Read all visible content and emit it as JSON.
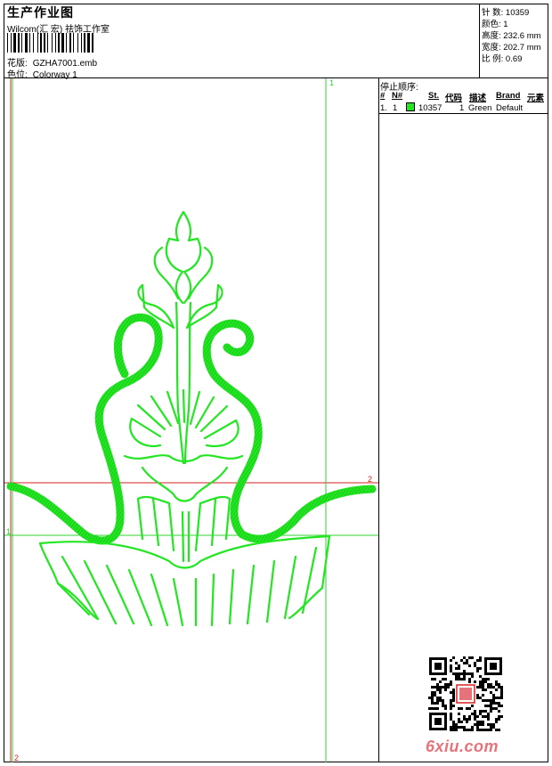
{
  "header": {
    "title": "生产作业图",
    "company": "Wilcom(汇 宏) 祛饰工作室",
    "design_label": "花版:",
    "design_value": "GZHA7001.emb",
    "colorway_label": "色位:",
    "colorway_value": "Colorway 1"
  },
  "stats": {
    "stitches_label": "针 数:",
    "stitches_value": "10359",
    "colors_label": "颜色:",
    "colors_value": "1",
    "height_label": "高度:",
    "height_value": "232.6 mm",
    "width_label": "宽度:",
    "width_value": "202.7 mm",
    "scale_label": "比 例:",
    "scale_value": "0.69"
  },
  "stop_sequence": {
    "title": "停止顺序:",
    "columns": [
      "#",
      "N#",
      "St.",
      "代码",
      "描述",
      "Brand",
      "元素"
    ],
    "rows": [
      {
        "index": "1.",
        "needle": "1",
        "swatch_color": "#22e622",
        "stitches": "10357",
        "code": "1",
        "description": "Green",
        "brand": "Default",
        "element": ""
      }
    ]
  },
  "guides": {
    "top_marker": "1",
    "right_marker": "2",
    "left_marker": "1",
    "bottom_marker": "2"
  },
  "colors": {
    "thread": "#22e622",
    "guide_green": "#2fd12f",
    "guide_red": "#d62020",
    "watermark": "#e7737a"
  },
  "watermark": {
    "text": "6xiu.com"
  }
}
